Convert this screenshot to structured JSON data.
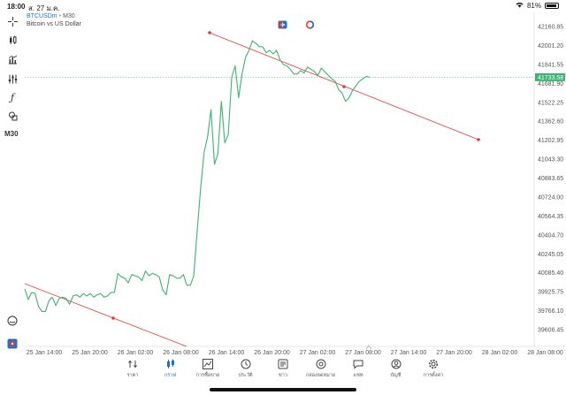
{
  "status": {
    "time": "18:00",
    "date": "ส. 27 ม.ค.",
    "battery": "81%",
    "battery_level": 0.81
  },
  "symbol": {
    "ticker": "BTCUSDm",
    "timeframe": "M30",
    "description": "Bitcoin vs US Dollar"
  },
  "toolbar": {
    "timeframe_label": "M30",
    "icons": [
      "crosshair-icon",
      "chart-type-icon",
      "indicators-icon",
      "settings-sliders-icon",
      "function-icon",
      "shapes-icon",
      "magnet-icon",
      "bell-icon"
    ]
  },
  "colors": {
    "price_line": "#3cb371",
    "trend_line": "#e53935",
    "accent": "#1a73c7",
    "current_price_bg": "#3cb371"
  },
  "chart_data": {
    "type": "line",
    "price_axis": [
      "42160.85",
      "42001.20",
      "41841.55",
      "41681.90",
      "41522.25",
      "41362.60",
      "41202.95",
      "41043.30",
      "40883.65",
      "40724.00",
      "40564.35",
      "40404.70",
      "40245.05",
      "40085.40",
      "39925.75",
      "39766.10",
      "39606.45"
    ],
    "time_axis": [
      "25 Jan 14:00",
      "25 Jan 20:00",
      "26 Jan 02:00",
      "26 Jan 08:00",
      "26 Jan 14:00",
      "26 Jan 20:00",
      "27 Jan 02:00",
      "27 Jan 08:00",
      "27 Jan 14:00",
      "27 Jan 20:00",
      "28 Jan 02:00",
      "28 Jan 08:00"
    ],
    "current_price": "41733.58",
    "ylim": [
      39606.45,
      42160.85
    ],
    "series": [
      {
        "values": [
          39950,
          39860,
          39920,
          39910,
          39800,
          39760,
          39760,
          39850,
          39880,
          39810,
          39870,
          39880,
          39870,
          39820,
          39890,
          39900,
          39880,
          39910,
          39890,
          39910,
          39880,
          39900,
          39910,
          39880,
          39890,
          39920,
          39920,
          40080,
          40050,
          40040,
          40000,
          40070,
          40060,
          40050,
          40020,
          40100,
          40060,
          40080,
          40070,
          40050,
          39940,
          39900,
          40070,
          40060,
          40040,
          40040,
          40070,
          39980,
          39980,
          40060,
          40440,
          40800,
          41100,
          41230,
          41460,
          41000,
          41090,
          41530,
          41180,
          41250,
          41730,
          41830,
          41560,
          41760,
          41900,
          41960,
          42040,
          42020,
          41990,
          41990,
          41940,
          41960,
          41930,
          41960,
          41880,
          41840,
          41830,
          41800,
          41760,
          41760,
          41790,
          41770,
          41820,
          41800,
          41780,
          41750,
          41810,
          41780,
          41750,
          41720,
          41700,
          41630,
          41600,
          41530,
          41560,
          41620,
          41660,
          41700,
          41720,
          41740,
          41733.58
        ]
      }
    ],
    "trend_lines": [
      {
        "points": [
          [
            0,
            40000
          ],
          [
            56,
            39570
          ]
        ]
      },
      {
        "points": [
          [
            62,
            42070
          ],
          [
            100,
            41200
          ]
        ]
      }
    ]
  },
  "nav": [
    {
      "label": "ราคา",
      "icon": "quotes-icon",
      "active": false
    },
    {
      "label": "กราฟ",
      "icon": "candles-icon",
      "active": true
    },
    {
      "label": "การซื้อขาย",
      "icon": "trade-chart-icon",
      "active": false
    },
    {
      "label": "ประวัติ",
      "icon": "history-icon",
      "active": false
    },
    {
      "label": "ข่าว",
      "icon": "news-icon",
      "active": false
    },
    {
      "label": "กล่องจดหมาย",
      "icon": "mail-icon",
      "active": false
    },
    {
      "label": "แชท",
      "icon": "chat-icon",
      "active": false
    },
    {
      "label": "บัญชี",
      "icon": "account-icon",
      "active": false
    },
    {
      "label": "การตั้งค่า",
      "icon": "gear-icon",
      "active": false
    }
  ]
}
